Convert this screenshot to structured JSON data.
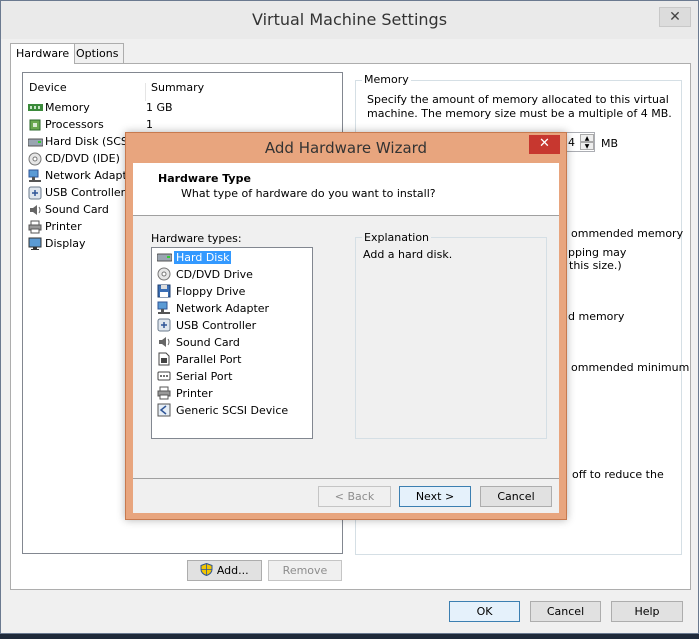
{
  "window": {
    "title": "Virtual Machine Settings",
    "close_glyph": "✕"
  },
  "tabs": [
    {
      "label": "Hardware",
      "active": true
    },
    {
      "label": "Options",
      "active": false
    }
  ],
  "device_list": {
    "col_device": "Device",
    "col_summary": "Summary",
    "rows": [
      {
        "name": "Memory",
        "summary": "1 GB",
        "icon": "memory-icon"
      },
      {
        "name": "Processors",
        "summary": "1",
        "icon": "processor-icon"
      },
      {
        "name": "Hard Disk (SCSI)",
        "summary": "",
        "icon": "hard-disk-icon"
      },
      {
        "name": "CD/DVD (IDE)",
        "summary": "",
        "icon": "cd-dvd-icon"
      },
      {
        "name": "Network Adapter",
        "summary": "",
        "icon": "network-adapter-icon"
      },
      {
        "name": "USB Controller",
        "summary": "",
        "icon": "usb-icon"
      },
      {
        "name": "Sound Card",
        "summary": "",
        "icon": "sound-card-icon"
      },
      {
        "name": "Printer",
        "summary": "",
        "icon": "printer-icon"
      },
      {
        "name": "Display",
        "summary": "",
        "icon": "display-icon"
      }
    ],
    "add_label": "Add...",
    "remove_label": "Remove"
  },
  "memory_panel": {
    "group_label": "Memory",
    "description_line1": "Specify the amount of memory allocated to this virtual",
    "description_line2": "machine. The memory size must be a multiple of 4 MB.",
    "spin_value_fragment": "4",
    "unit": "MB",
    "fragment_1": "ommended memory",
    "fragment_2": "pping may",
    "fragment_3": "this size.)",
    "fragment_4": "d memory",
    "fragment_5": "ommended minimum",
    "fragment_6": "off to reduce the"
  },
  "footer": {
    "ok_label": "OK",
    "cancel_label": "Cancel",
    "help_label": "Help"
  },
  "wizard": {
    "title": "Add Hardware Wizard",
    "close_glyph": "✕",
    "header_title": "Hardware Type",
    "header_subtitle": "What type of hardware do you want to install?",
    "types_label": "Hardware types:",
    "types": [
      {
        "label": "Hard Disk",
        "icon": "hard-disk-icon",
        "selected": true
      },
      {
        "label": "CD/DVD Drive",
        "icon": "cd-dvd-icon",
        "selected": false
      },
      {
        "label": "Floppy Drive",
        "icon": "floppy-icon",
        "selected": false
      },
      {
        "label": "Network Adapter",
        "icon": "network-adapter-icon",
        "selected": false
      },
      {
        "label": "USB Controller",
        "icon": "usb-icon",
        "selected": false
      },
      {
        "label": "Sound Card",
        "icon": "sound-card-icon",
        "selected": false
      },
      {
        "label": "Parallel Port",
        "icon": "parallel-port-icon",
        "selected": false
      },
      {
        "label": "Serial Port",
        "icon": "serial-port-icon",
        "selected": false
      },
      {
        "label": "Printer",
        "icon": "printer-icon",
        "selected": false
      },
      {
        "label": "Generic SCSI Device",
        "icon": "scsi-icon",
        "selected": false
      }
    ],
    "explanation_label": "Explanation",
    "explanation_text": "Add a hard disk.",
    "back_label": "< Back",
    "next_label": "Next >",
    "cancel_label": "Cancel"
  },
  "colors": {
    "dialog_frame": "#e8a57e",
    "close_red": "#c7372f",
    "selection": "#3399ff"
  }
}
